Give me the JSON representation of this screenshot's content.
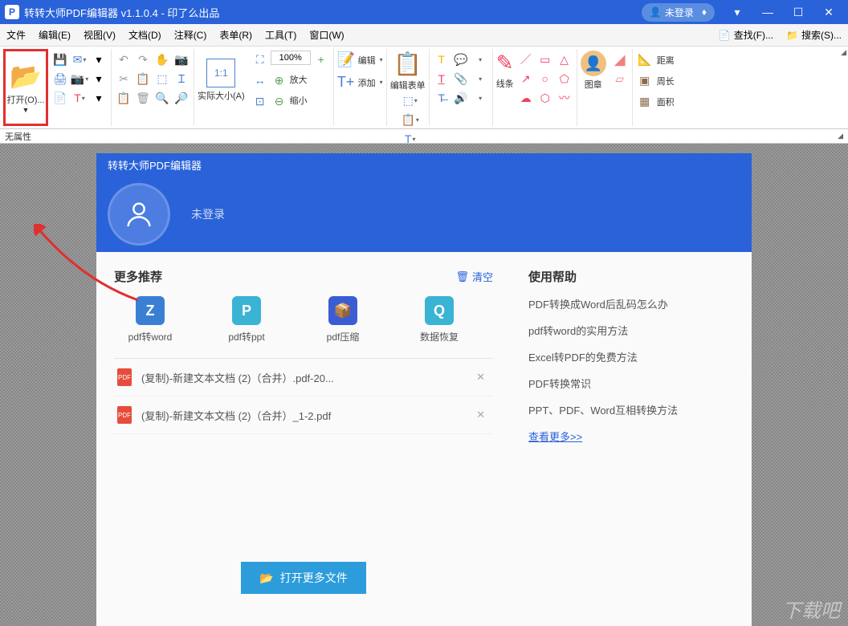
{
  "title": "转转大师PDF编辑器 v1.1.0.4 - 印了么出品",
  "login_badge": "未登录",
  "menubar": [
    "文件",
    "编辑(E)",
    "视图(V)",
    "文档(D)",
    "注释(C)",
    "表单(R)",
    "工具(T)",
    "窗口(W)"
  ],
  "menubar_right": [
    {
      "icon": "🔍",
      "label": "查找(F)..."
    },
    {
      "icon": "📁",
      "label": "搜索(S)..."
    }
  ],
  "ribbon": {
    "open": "打开(O)...",
    "actual_size": "实际大小(A)",
    "zoom_value": "100%",
    "zoom_in": "放大",
    "zoom_out": "缩小",
    "edit": "编辑",
    "add": "添加",
    "edit_form": "编辑表单",
    "line": "线条",
    "stamp": "图章",
    "distance": "距离",
    "perimeter": "周长",
    "area": "面积"
  },
  "status": "无属性",
  "panel": {
    "header": "转转大师PDF编辑器",
    "login_status": "未登录",
    "recommend_title": "更多推荐",
    "clear": "清空",
    "recommends": [
      {
        "label": "pdf转word",
        "color": "#3b7fd4",
        "glyph": "Z"
      },
      {
        "label": "pdf转ppt",
        "color": "#3bb3d4",
        "glyph": "P"
      },
      {
        "label": "pdf压缩",
        "color": "#3b5dd4",
        "glyph": "📦"
      },
      {
        "label": "数据恢复",
        "color": "#3bb3d4",
        "glyph": "Q"
      }
    ],
    "files": [
      "(复制)-新建文本文档 (2)（合并）.pdf-20...",
      "(复制)-新建文本文档 (2)（合并）_1-2.pdf"
    ],
    "help_title": "使用帮助",
    "help_links": [
      "PDF转换成Word后乱码怎么办",
      "pdf转word的实用方法",
      "Excel转PDF的免费方法",
      "PDF转换常识",
      "PPT、PDF、Word互相转换方法"
    ],
    "help_more": "查看更多>>",
    "open_more": "打开更多文件"
  },
  "watermark": "下载吧"
}
